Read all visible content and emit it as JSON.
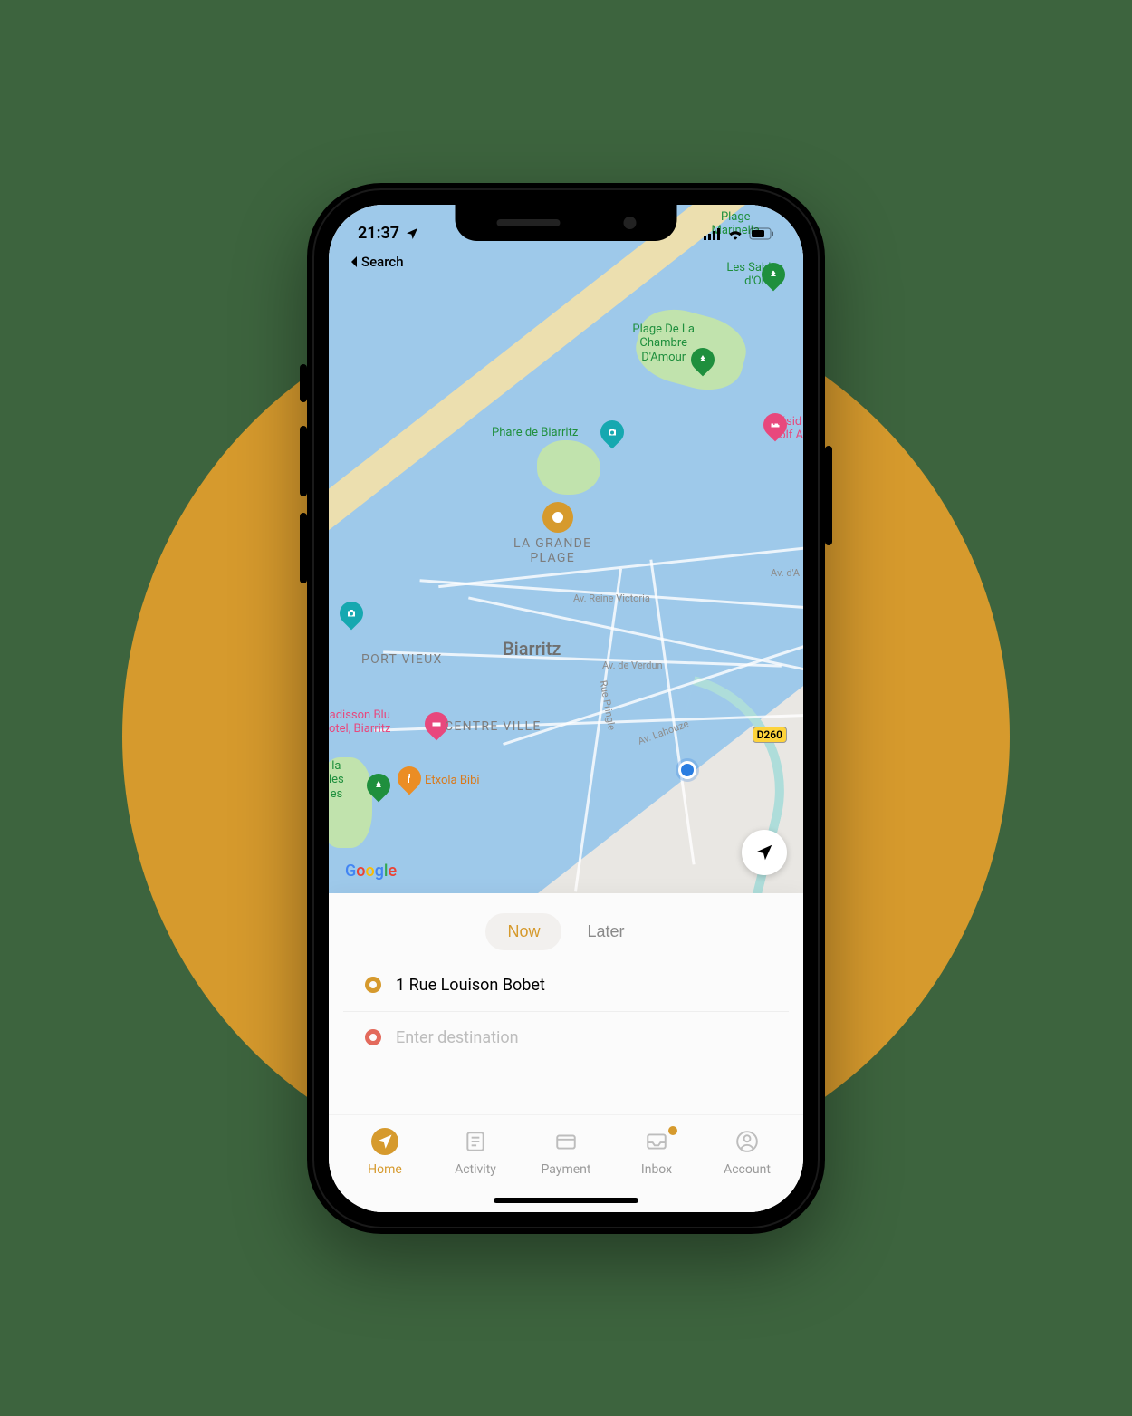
{
  "status": {
    "time": "21:37",
    "back_label": "Search"
  },
  "map": {
    "city": "Biarritz",
    "districts": {
      "grande_plage": "LA GRANDE\nPLAGE",
      "port_vieux": "PORT VIEUX",
      "centre_ville": "CENTRE VILLE"
    },
    "roads": {
      "victoria": "Av. Reine Victoria",
      "verdun": "Av. de Verdun",
      "pringle": "Rue Pringle",
      "lahouze": "Av. Lahouze",
      "avda_top": "Av. d'A",
      "d260": "D260"
    },
    "pois": {
      "marinella": "Plage\nMarinella",
      "sables": "Les Sables\nd'Or",
      "chambre": "Plage De La\nChambre\nD'Amour",
      "phare": "Phare de Biarritz",
      "radisson": "adisson Blu\notel, Biarritz",
      "residence": "Résid\nGolf A",
      "etxola": "Etxola Bibi",
      "la_les_es": "la\nles\nes"
    },
    "attribution": "Google"
  },
  "sheet": {
    "seg_now": "Now",
    "seg_later": "Later",
    "pickup": "1 Rue Louison Bobet",
    "destination_placeholder": "Enter destination"
  },
  "tabs": {
    "home": "Home",
    "activity": "Activity",
    "payment": "Payment",
    "inbox": "Inbox",
    "account": "Account"
  }
}
